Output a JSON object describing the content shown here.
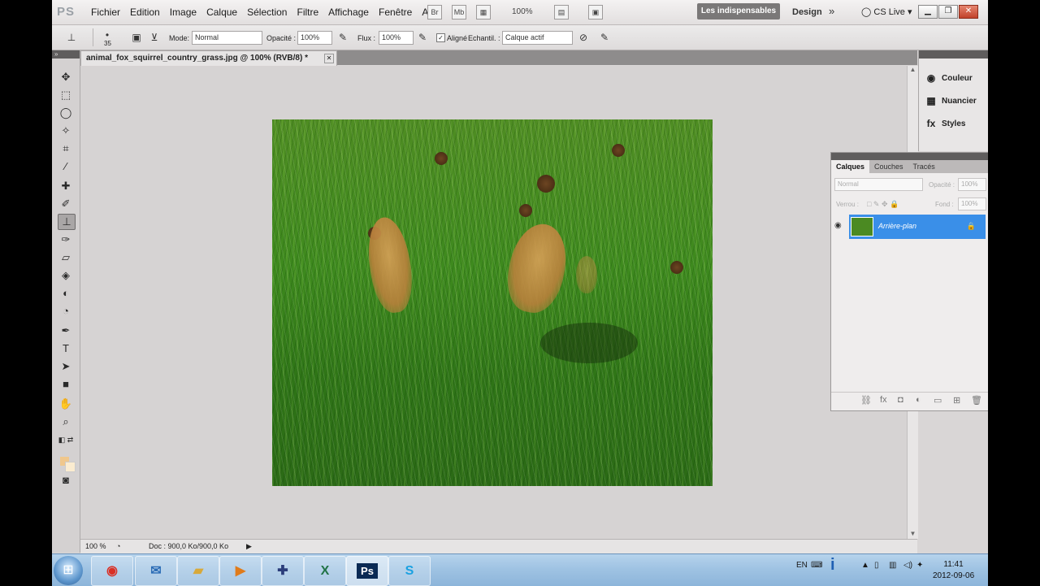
{
  "app": {
    "logo": "PS"
  },
  "menu": [
    "Fichier",
    "Edition",
    "Image",
    "Calque",
    "Sélection",
    "Filtre",
    "Affichage",
    "Fenêtre",
    "Aide"
  ],
  "appbar": {
    "bridge": "Br",
    "minibridge": "Mb",
    "zoom": "100%",
    "workspace_active": "Les indispensables",
    "workspace_design": "Design",
    "more": "»",
    "cslive": "CS Live"
  },
  "options": {
    "brush_size": "35",
    "mode_label": "Mode:",
    "mode_value": "Normal",
    "opacity_label": "Opacité :",
    "opacity_value": "100%",
    "flow_label": "Flux :",
    "flow_value": "100%",
    "aligned_label": "Aligné",
    "aligned_checked": true,
    "sample_label": "Echantil. :",
    "sample_value": "Calque actif"
  },
  "document": {
    "tab_title": "animal_fox_squirrel_country_grass.jpg @ 100% (RVB/8) *",
    "zoom": "100 %",
    "doc_info": "Doc : 900,0 Ko/900,0 Ko"
  },
  "dock": {
    "items": [
      {
        "label": "Couleur",
        "icon": "color-icon"
      },
      {
        "label": "Nuancier",
        "icon": "swatches-icon"
      },
      {
        "label": "Styles",
        "icon": "styles-icon"
      }
    ]
  },
  "layers_panel": {
    "tabs": [
      "Calques",
      "Couches",
      "Tracés"
    ],
    "blend_mode": "Normal",
    "opacity_label": "Opacité :",
    "opacity_value": "100%",
    "lock_label": "Verrou :",
    "fill_label": "Fond :",
    "fill_value": "100%",
    "layer_name": "Arrière-plan"
  },
  "taskbar": {
    "apps": [
      "chrome",
      "thunderbird",
      "explorer",
      "media-player",
      "unknown",
      "excel",
      "photoshop",
      "skype"
    ],
    "ps_label": "Ps",
    "lang": "EN",
    "time": "11:41",
    "date": "2012-09-06"
  },
  "colors": {
    "layer_selected": "#3a8fe8",
    "workspace_button": "#7a7878",
    "foreground": "#f0c78c",
    "background": "#fbecd0"
  }
}
